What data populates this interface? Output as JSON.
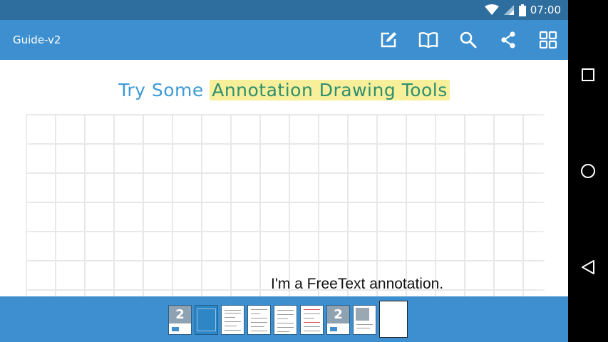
{
  "status_bar": {
    "time": "07:00"
  },
  "app_bar": {
    "title": "Guide-v2",
    "actions": [
      {
        "name": "edit-icon"
      },
      {
        "name": "book-icon"
      },
      {
        "name": "search-icon"
      },
      {
        "name": "share-icon"
      },
      {
        "name": "grid-icon"
      }
    ]
  },
  "document": {
    "heading_plain": "Try Some",
    "heading_highlight": "Annotation Drawing Tools",
    "freetext": "I'm a FreeText annotation."
  },
  "thumbnails": {
    "pages": [
      "cover",
      "blue",
      "text",
      "text",
      "text",
      "text",
      "cover",
      "grey",
      "current"
    ]
  },
  "nav_bar": {
    "buttons": [
      "recents-icon",
      "home-icon",
      "back-icon"
    ]
  },
  "colors": {
    "status_bar": "#2e6e9e",
    "app_bar": "#3d8fcf",
    "heading": "#3d9ad6",
    "highlight": "#f7ef9a"
  }
}
